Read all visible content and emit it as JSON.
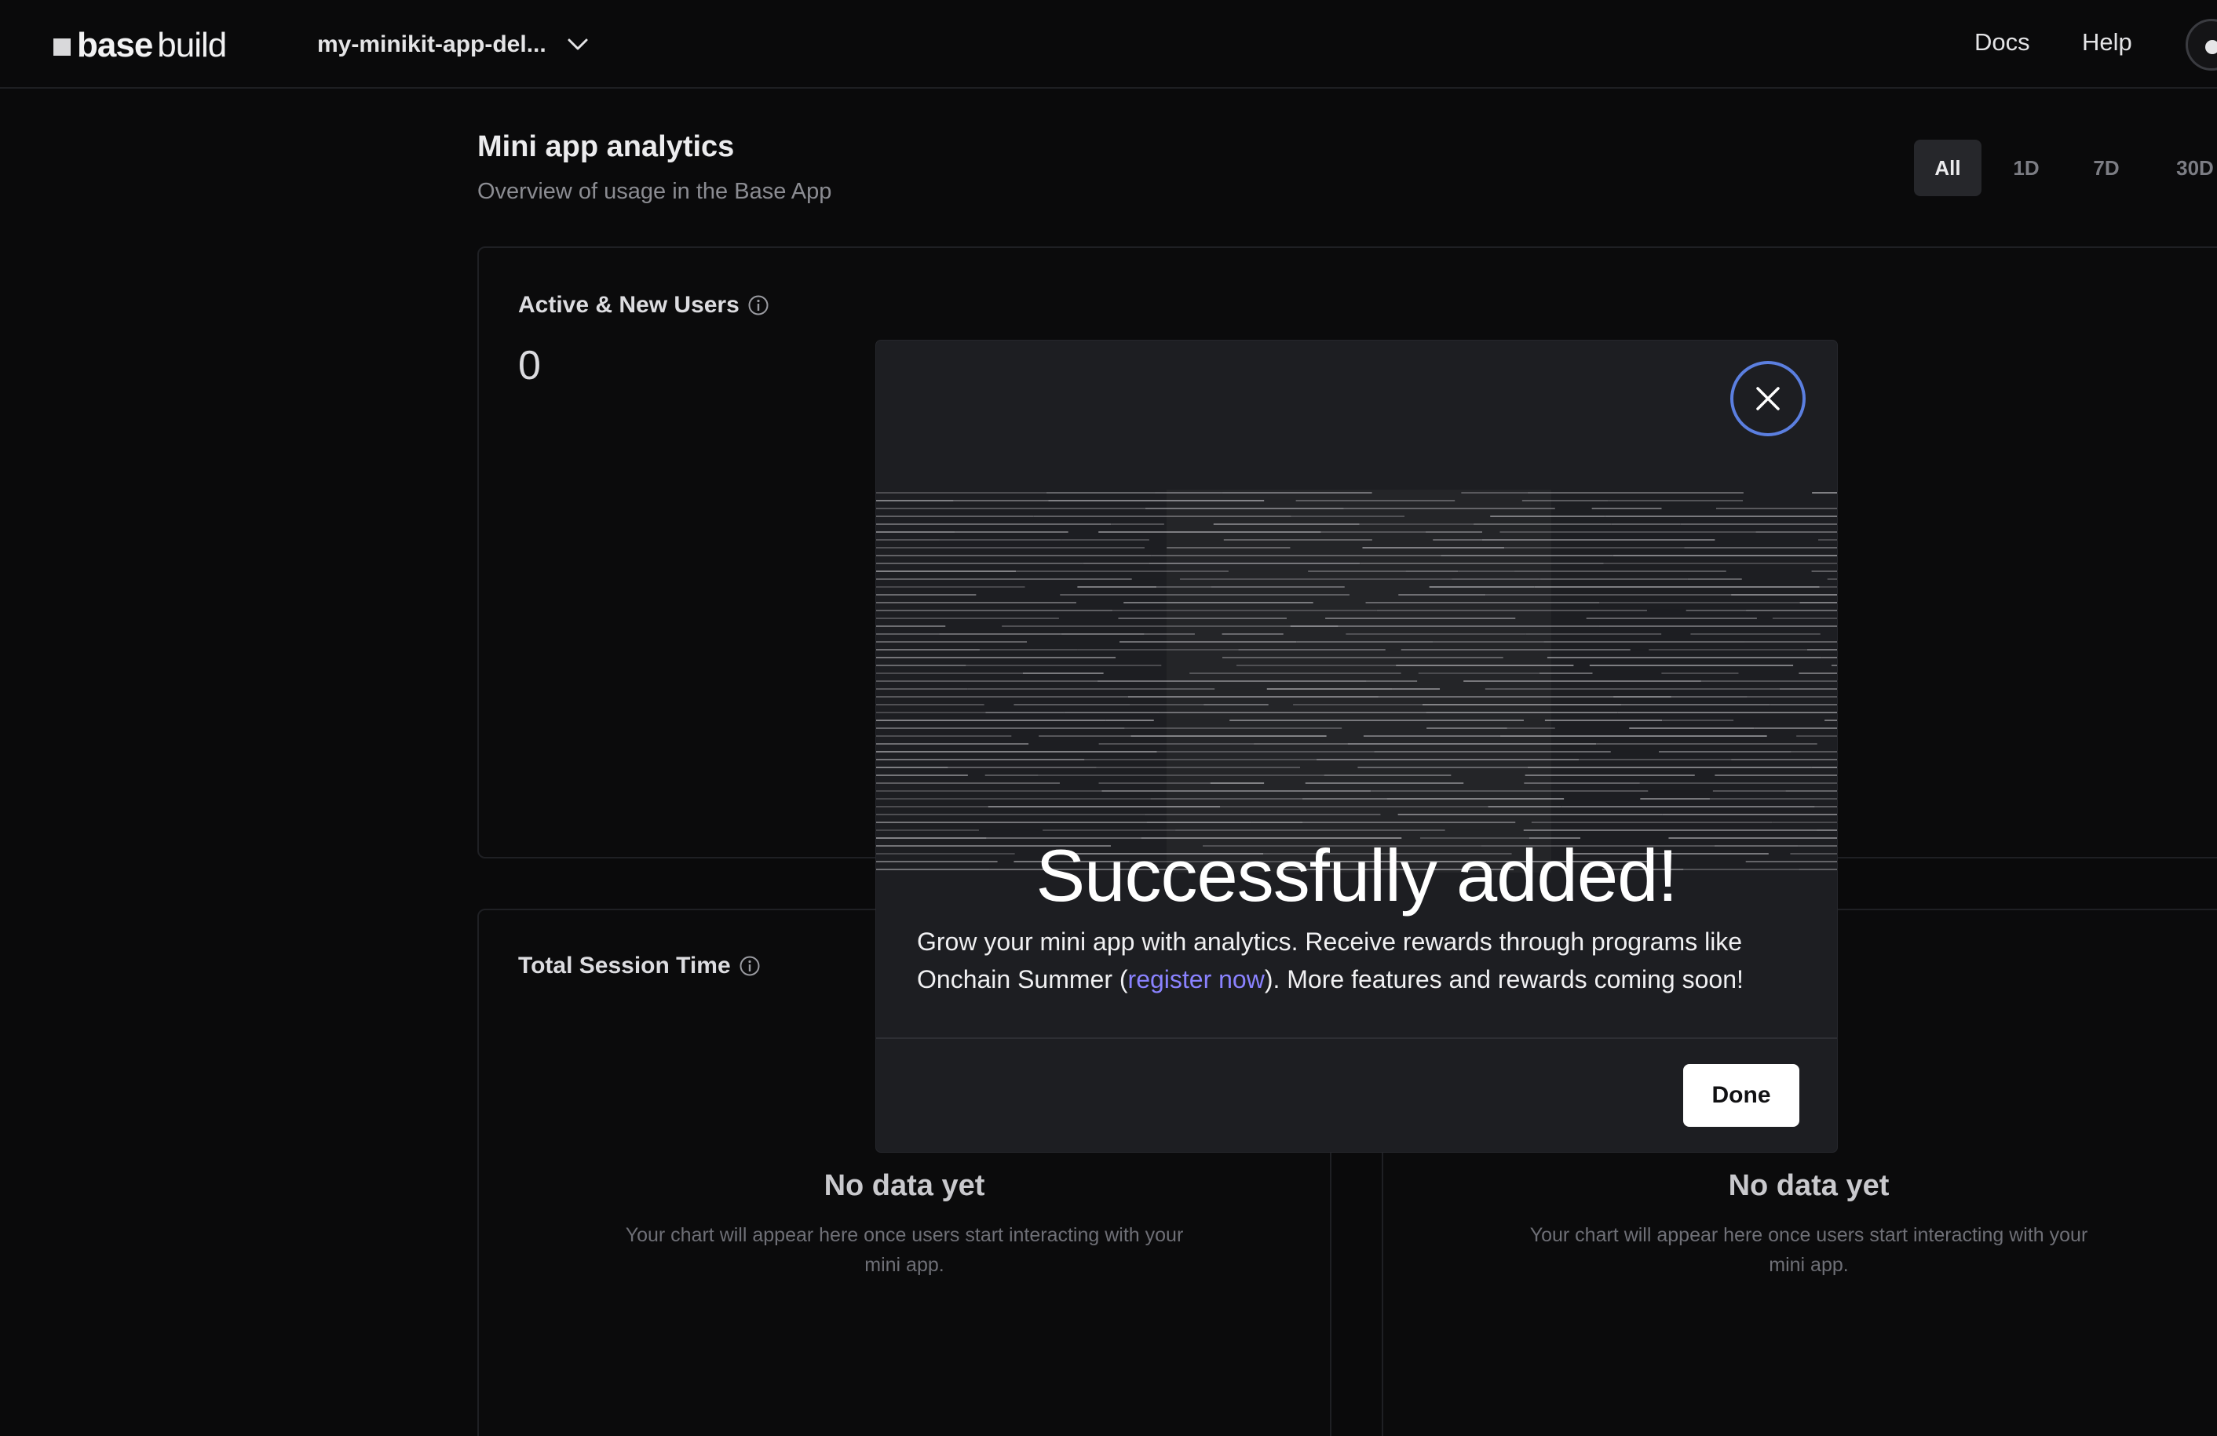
{
  "topbar": {
    "brand_base": "base",
    "brand_build": "build",
    "app_selector_label": "my-minikit-app-del...",
    "nav_docs": "Docs",
    "nav_help": "Help"
  },
  "header": {
    "title": "Mini app analytics",
    "subtitle": "Overview of usage in the Base App",
    "range_tabs": [
      {
        "label": "All",
        "active": true
      },
      {
        "label": "1D",
        "active": false
      },
      {
        "label": "7D",
        "active": false
      },
      {
        "label": "30D",
        "active": false
      }
    ]
  },
  "cards": {
    "users": {
      "title": "Active & New Users",
      "value": "0"
    },
    "session": {
      "title": "Total Session Time"
    },
    "empty_state": {
      "title": "No data yet",
      "description": "Your chart will appear here once users start interacting with your mini app."
    }
  },
  "modal": {
    "title": "Successfully added!",
    "text_before_link": "Grow your mini app with analytics. Receive rewards through programs like Onchain Summer (",
    "link_text": "register now",
    "text_after_link": "). More features and rewards coming soon!",
    "done_label": "Done"
  },
  "colors": {
    "background": "#0a0a0b",
    "modal_background": "#1d1e22",
    "link": "#8a82ff",
    "close_ring": "#5b7fe0",
    "done_button": "#ffffff"
  },
  "icons": {
    "app_selector": "chevron-down-icon",
    "card_info": "info-icon",
    "modal_close": "close-icon"
  }
}
